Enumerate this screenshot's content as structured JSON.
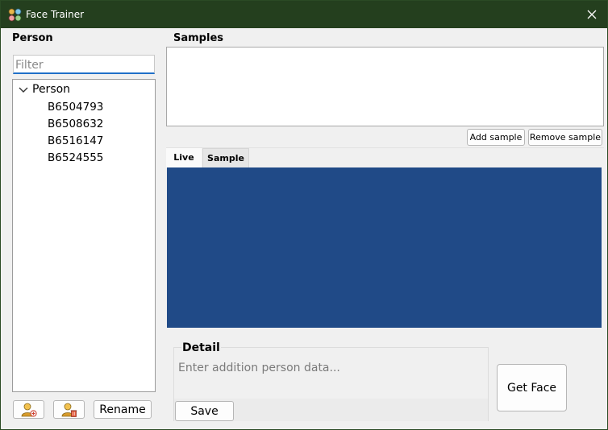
{
  "window": {
    "title": "Face Trainer",
    "title_bar_color": "#243f1e",
    "close_icon": "close-icon"
  },
  "person_panel": {
    "label": "Person",
    "filter_placeholder": "Filter",
    "tree": {
      "root_label": "Person",
      "expanded": true,
      "items": [
        "B6504793",
        "B6508632",
        "B6516147",
        "B6524555"
      ]
    },
    "buttons": {
      "add_person_icon": "add-person-icon",
      "delete_person_icon": "delete-person-icon",
      "rename_label": "Rename"
    }
  },
  "samples_panel": {
    "label": "Samples",
    "add_sample_label": "Add sample",
    "remove_sample_label": "Remove sample",
    "tabs": [
      {
        "label": "Live",
        "active": true
      },
      {
        "label": "Sample",
        "active": false
      }
    ],
    "live_view_color": "#204a87"
  },
  "detail_panel": {
    "label": "Detail",
    "input_placeholder": "Enter addition person data...",
    "save_label": "Save"
  },
  "get_face_label": "Get Face"
}
